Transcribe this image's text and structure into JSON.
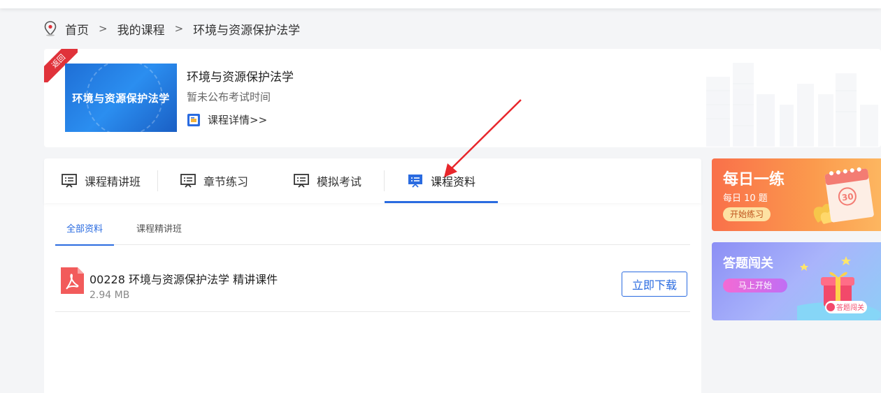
{
  "breadcrumb": {
    "items": [
      "首页",
      "我的课程",
      "环境与资源保护法学"
    ],
    "separator": ">"
  },
  "course": {
    "ribbon_label": "返回",
    "thumbnail_title": "环境与资源保护法学",
    "title": "环境与资源保护法学",
    "exam_time": "暂未公布考试时间",
    "detail_link": "课程详情>>"
  },
  "tabs": [
    {
      "label": "课程精讲班",
      "active": false
    },
    {
      "label": "章节练习",
      "active": false
    },
    {
      "label": "模拟考试",
      "active": false
    },
    {
      "label": "课程资料",
      "active": true
    }
  ],
  "subtabs": [
    {
      "label": "全部资料",
      "active": true
    },
    {
      "label": "课程精讲班",
      "active": false
    }
  ],
  "files": [
    {
      "name": "00228 环境与资源保护法学 精讲课件",
      "size": "2.94 MB",
      "action": "立即下载",
      "type_icon": "pdf-icon"
    }
  ],
  "banners": {
    "daily": {
      "title": "每日一练",
      "subtitle": "每日 10 题",
      "button": "开始练习",
      "badge": "30"
    },
    "quiz": {
      "title": "答题闯关",
      "button": "马上开始",
      "badge": "答题闯关"
    }
  },
  "colors": {
    "accent": "#2a6be0",
    "ribbon": "#e0323a",
    "pdf": "#f25b5b",
    "annotation_arrow": "#e8262b"
  }
}
